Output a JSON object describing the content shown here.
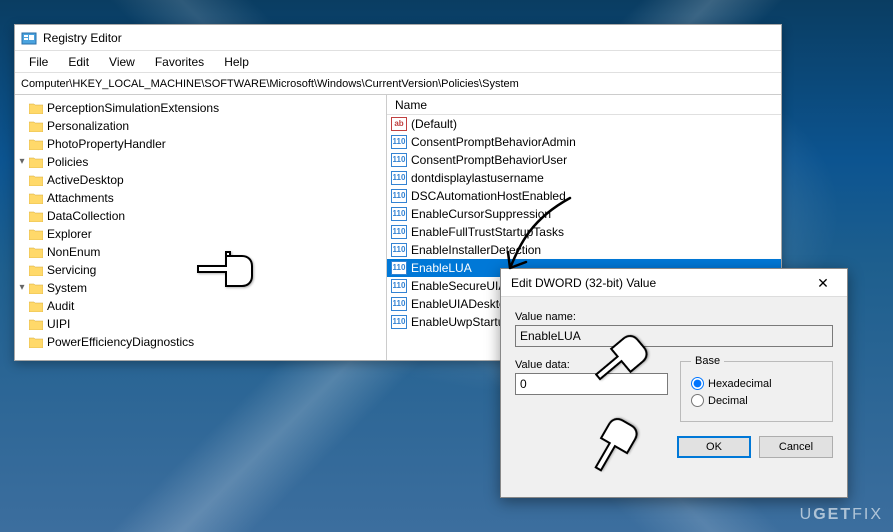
{
  "window": {
    "title": "Registry Editor",
    "menu": {
      "file": "File",
      "edit": "Edit",
      "view": "View",
      "favorites": "Favorites",
      "help": "Help"
    },
    "path": "Computer\\HKEY_LOCAL_MACHINE\\SOFTWARE\\Microsoft\\Windows\\CurrentVersion\\Policies\\System"
  },
  "tree": {
    "items": [
      {
        "label": "PerceptionSimulationExtensions",
        "indent": "indent2",
        "expand": ""
      },
      {
        "label": "Personalization",
        "indent": "indent2",
        "expand": ""
      },
      {
        "label": "PhotoPropertyHandler",
        "indent": "indent2",
        "expand": ""
      },
      {
        "label": "Policies",
        "indent": "indent2",
        "expand": "v"
      },
      {
        "label": "ActiveDesktop",
        "indent": "indent3",
        "expand": ""
      },
      {
        "label": "Attachments",
        "indent": "indent3",
        "expand": ""
      },
      {
        "label": "DataCollection",
        "indent": "indent3",
        "expand": ""
      },
      {
        "label": "Explorer",
        "indent": "indent3",
        "expand": ""
      },
      {
        "label": "NonEnum",
        "indent": "indent3",
        "expand": ""
      },
      {
        "label": "Servicing",
        "indent": "indent3",
        "expand": ""
      },
      {
        "label": "System",
        "indent": "indent3",
        "expand": "v"
      },
      {
        "label": "Audit",
        "indent": "indent4",
        "expand": ""
      },
      {
        "label": "UIPI",
        "indent": "indent4",
        "expand": ""
      },
      {
        "label": "PowerEfficiencyDiagnostics",
        "indent": "indent2",
        "expand": ""
      }
    ]
  },
  "list": {
    "header": "Name",
    "values": [
      {
        "name": "(Default)",
        "type": "str",
        "selected": false
      },
      {
        "name": "ConsentPromptBehaviorAdmin",
        "type": "dw",
        "selected": false
      },
      {
        "name": "ConsentPromptBehaviorUser",
        "type": "dw",
        "selected": false
      },
      {
        "name": "dontdisplaylastusername",
        "type": "dw",
        "selected": false
      },
      {
        "name": "DSCAutomationHostEnabled",
        "type": "dw",
        "selected": false
      },
      {
        "name": "EnableCursorSuppression",
        "type": "dw",
        "selected": false
      },
      {
        "name": "EnableFullTrustStartupTasks",
        "type": "dw",
        "selected": false
      },
      {
        "name": "EnableInstallerDetection",
        "type": "dw",
        "selected": false
      },
      {
        "name": "EnableLUA",
        "type": "dw",
        "selected": true
      },
      {
        "name": "EnableSecureUIAPaths",
        "type": "dw",
        "selected": false
      },
      {
        "name": "EnableUIADesktopToggle",
        "type": "dw",
        "selected": false
      },
      {
        "name": "EnableUwpStartupTasks",
        "type": "dw",
        "selected": false
      }
    ]
  },
  "dialog": {
    "title": "Edit DWORD (32-bit) Value",
    "value_name_label": "Value name:",
    "value_name": "EnableLUA",
    "value_data_label": "Value data:",
    "value_data": "0",
    "base_label": "Base",
    "hex_label": "Hexadecimal",
    "dec_label": "Decimal",
    "ok": "OK",
    "cancel": "Cancel"
  },
  "watermark": {
    "text1": "U",
    "text2": "GET",
    "text3": "FIX"
  }
}
